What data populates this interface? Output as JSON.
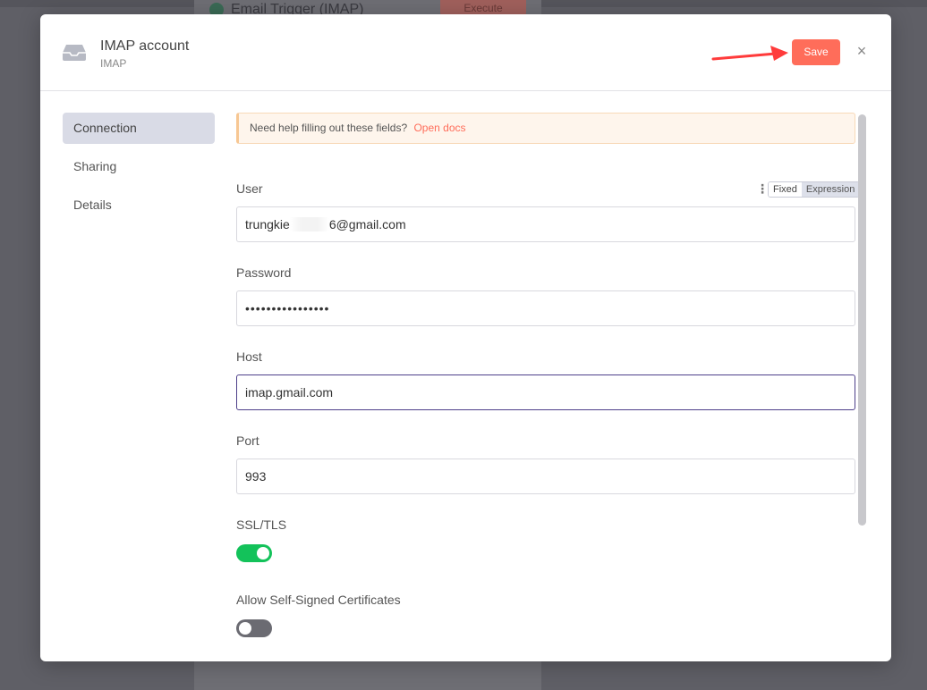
{
  "background": {
    "node_title": "Email Trigger (IMAP)",
    "node_button": "Execute"
  },
  "modal": {
    "title": "IMAP account",
    "subtitle": "IMAP",
    "save_label": "Save",
    "close_glyph": "×",
    "header_icon": "inbox-icon",
    "arrow_color": "#ff3b3b"
  },
  "sidebar": {
    "items": [
      {
        "label": "Connection",
        "active": true
      },
      {
        "label": "Sharing",
        "active": false
      },
      {
        "label": "Details",
        "active": false
      }
    ]
  },
  "notice": {
    "text": "Need help filling out these fields?",
    "link": "Open docs"
  },
  "fields": {
    "user": {
      "label": "User",
      "value_start": "trungkie",
      "value_end": "6@gmail.com",
      "mode_options": [
        "Fixed",
        "Expression"
      ],
      "mode_selected": "Fixed",
      "menu_glyph": "⋮"
    },
    "password": {
      "label": "Password",
      "value": "••••••••••••••••"
    },
    "host": {
      "label": "Host",
      "value": "imap.gmail.com"
    },
    "port": {
      "label": "Port",
      "value": "993"
    },
    "ssl": {
      "label": "SSL/TLS",
      "enabled": true
    },
    "self_signed": {
      "label": "Allow Self-Signed Certificates",
      "enabled": false
    }
  },
  "colors": {
    "accent": "#ff6d5a",
    "toggle_on": "#13c25a",
    "toggle_off": "#6b6b72",
    "focus_border": "#4d3f8a",
    "notice_bg": "#fef5ec"
  }
}
